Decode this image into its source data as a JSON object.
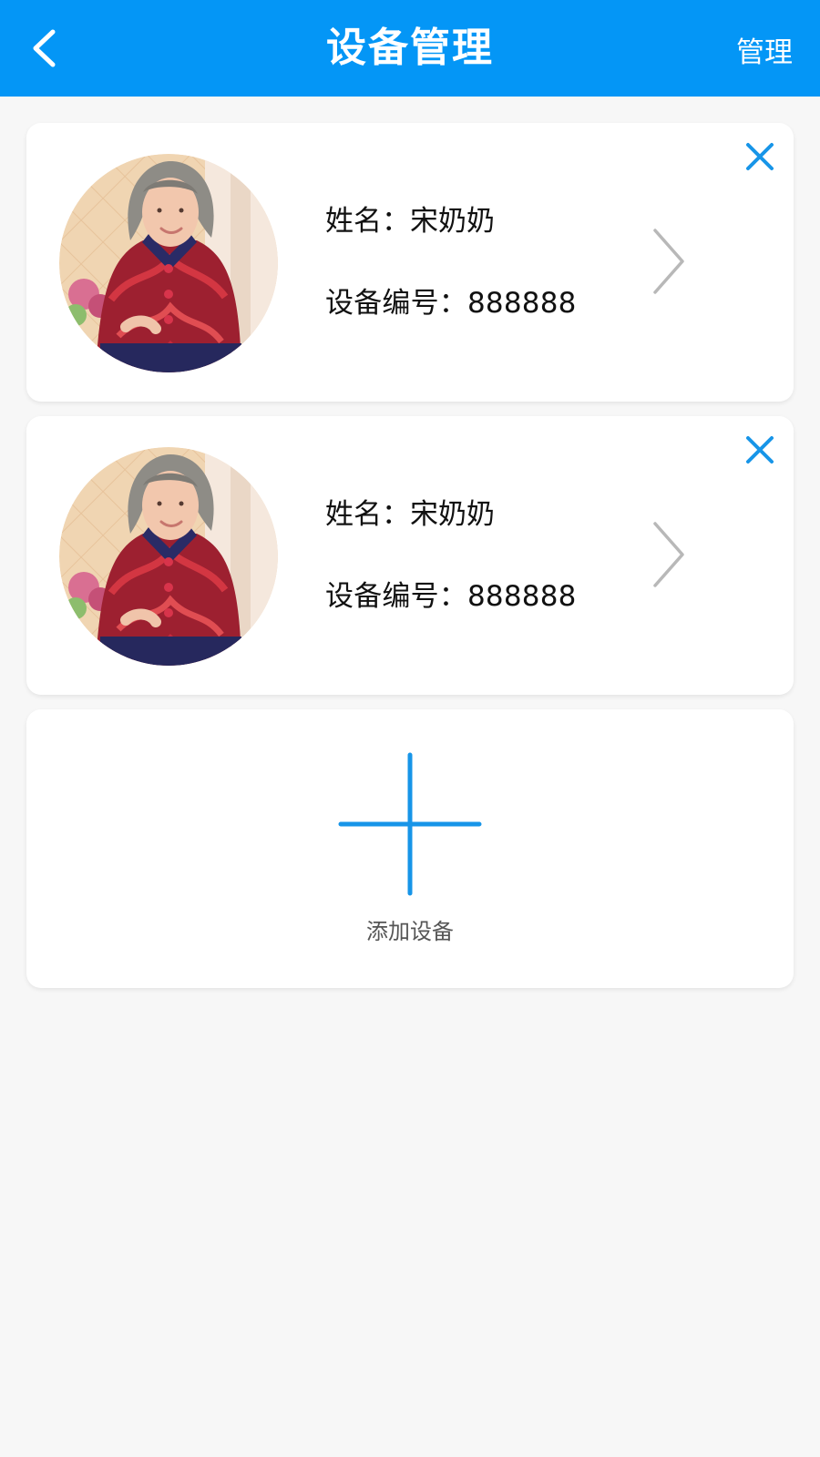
{
  "header": {
    "title": "设备管理",
    "manage_label": "管理",
    "back_icon": "chevron-left-icon",
    "background_color": "#0496f6"
  },
  "devices": [
    {
      "name_label": "姓名：",
      "name_value": "宋奶奶",
      "device_label": "设备编号：",
      "device_value": "888888",
      "avatar": "elderly-woman-photo",
      "delete_icon": "close-icon",
      "detail_icon": "chevron-right-icon"
    },
    {
      "name_label": "姓名：",
      "name_value": "宋奶奶",
      "device_label": "设备编号：",
      "device_value": "888888",
      "avatar": "elderly-woman-photo",
      "delete_icon": "close-icon",
      "detail_icon": "chevron-right-icon"
    }
  ],
  "add_device": {
    "label": "添加设备",
    "icon": "plus-icon",
    "accent_color": "#1795e8"
  }
}
